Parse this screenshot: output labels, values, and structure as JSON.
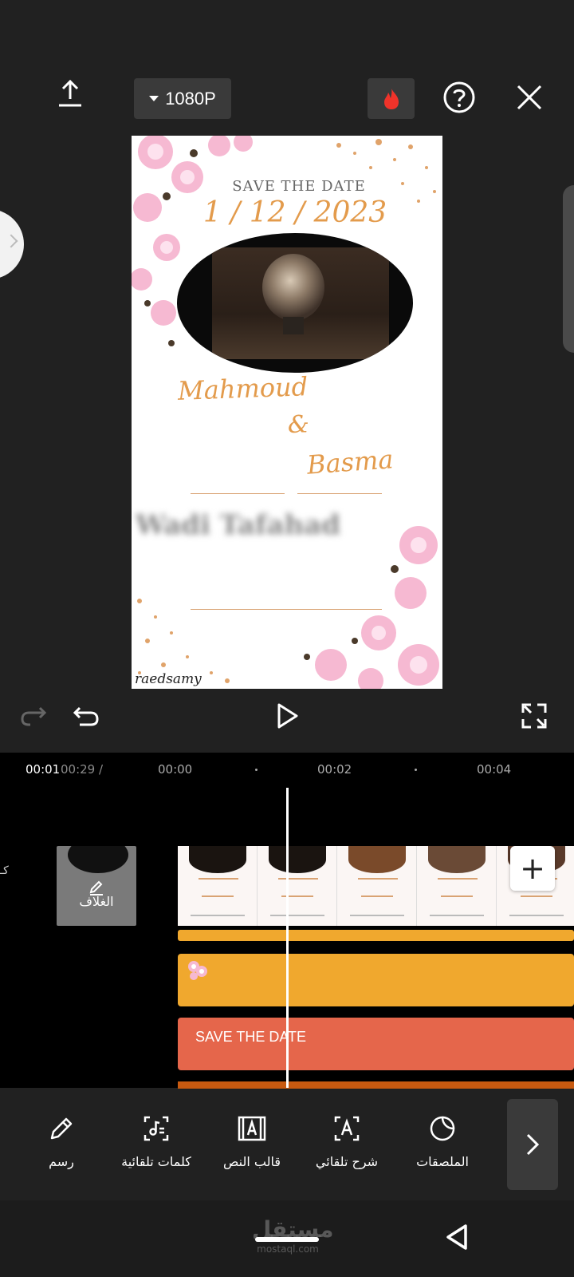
{
  "toolbar_top": {
    "resolution_label": "1080P",
    "export_icon": "upload-icon",
    "pro_icon": "flame-icon",
    "help_icon": "help-circle-icon",
    "close_icon": "close-icon"
  },
  "preview": {
    "save_the_date": "SAVE THE DATE",
    "date": "1 / 12 / 2023",
    "name1": "Mahmoud",
    "ampersand": "&",
    "name2": "Basma",
    "blurred_text": "Wadi Tafahad",
    "watermark": "raedsamy"
  },
  "playback": {
    "redo_icon": "redo-icon",
    "undo_icon": "undo-icon",
    "play_icon": "play-icon",
    "fullscreen_icon": "fullscreen-icon"
  },
  "timeline": {
    "current_time": "00:01",
    "total_time": "00:29 /",
    "ticks": [
      "00:00",
      "00:02",
      "00:04"
    ],
    "side_label": "كـ",
    "cover_label": "الغلاف",
    "add_icon": "plus-icon",
    "text_track_label": "SAVE THE DATE"
  },
  "tools": [
    {
      "label": "رسم",
      "icon": "pencil-icon"
    },
    {
      "label": "كلمات تلقائية",
      "icon": "auto-lyrics-icon"
    },
    {
      "label": "قالب النص",
      "icon": "text-template-icon"
    },
    {
      "label": "شرح تلقائي",
      "icon": "auto-caption-icon"
    },
    {
      "label": "الملصقات",
      "icon": "sticker-icon"
    }
  ],
  "navbar": {
    "watermark": "مستقل",
    "watermark_sub": "mostaql.com"
  },
  "colors": {
    "background": "#212121",
    "accent_orange": "#f0a82e",
    "text_track": "#e5664b",
    "script_gold": "#e39b4c"
  }
}
